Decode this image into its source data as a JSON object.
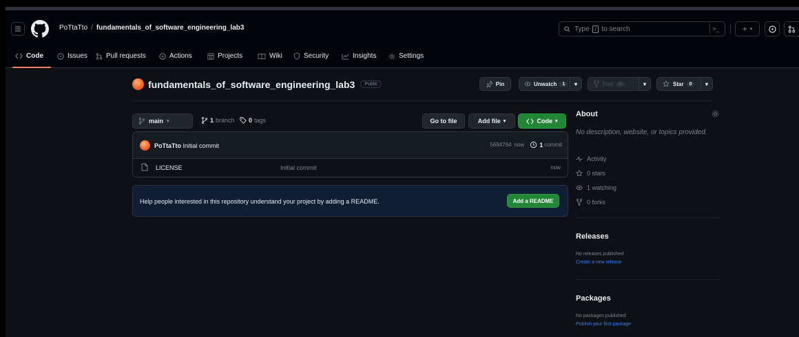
{
  "header": {
    "owner": "PoTtaTto",
    "separator": "/",
    "repo": "fundamentals_of_software_engineering_lab3",
    "search_before": "Type",
    "search_key": "/",
    "search_after": "to search",
    "cmd_symbol": ">_"
  },
  "tabs": [
    {
      "label": "Code",
      "icon": "code-icon"
    },
    {
      "label": "Issues",
      "icon": "issue-icon"
    },
    {
      "label": "Pull requests",
      "icon": "pull-request-icon"
    },
    {
      "label": "Actions",
      "icon": "actions-icon"
    },
    {
      "label": "Projects",
      "icon": "projects-icon"
    },
    {
      "label": "Wiki",
      "icon": "wiki-icon"
    },
    {
      "label": "Security",
      "icon": "shield-icon"
    },
    {
      "label": "Insights",
      "icon": "graph-icon"
    },
    {
      "label": "Settings",
      "icon": "gear-icon"
    }
  ],
  "repo": {
    "name": "fundamentals_of_software_engineering_lab3",
    "visibility": "Public",
    "pin_label": "Pin",
    "watch_label": "Unwatch",
    "watch_count": "1",
    "fork_label": "Fork",
    "fork_count": "0",
    "star_label": "Star",
    "star_count": "0"
  },
  "filenav": {
    "branch": "main",
    "branches_count": "1",
    "branches_label": "branch",
    "tags_count": "0",
    "tags_label": "tags",
    "goto_file": "Go to file",
    "add_file": "Add file",
    "code": "Code"
  },
  "commit": {
    "author": "PoTtaTto",
    "message": "Initial commit",
    "hash": "5694764",
    "time": "now",
    "count": "1",
    "count_label": "commit"
  },
  "files": [
    {
      "name": "LICENSE",
      "message": "Initial commit",
      "age": "now"
    }
  ],
  "readme_prompt": {
    "text": "Help people interested in this repository understand your project by adding a README.",
    "button": "Add a README"
  },
  "sidebar": {
    "about_title": "About",
    "about_desc": "No description, website, or topics provided.",
    "activity": "Activity",
    "stars": "0 stars",
    "watching": "1 watching",
    "forks": "0 forks",
    "releases_title": "Releases",
    "releases_none": "No releases published",
    "releases_link": "Create a new release",
    "packages_title": "Packages",
    "packages_none": "No packages published",
    "packages_link": "Publish your first package"
  },
  "colors": {
    "accent_underline": "#f78166",
    "green_button": "#238636",
    "link": "#2f81f7",
    "background": "#0d1117"
  }
}
